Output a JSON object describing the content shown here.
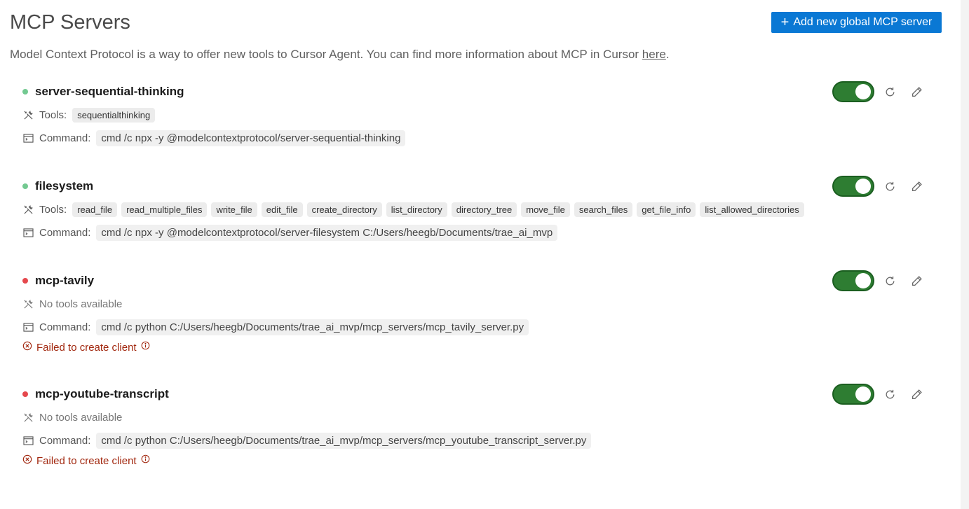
{
  "page": {
    "title": "MCP Servers",
    "add_button": "Add new global MCP server",
    "description": "Model Context Protocol is a way to offer new tools to Cursor Agent. You can find more information about MCP in Cursor ",
    "description_link": "here",
    "description_end": "."
  },
  "labels": {
    "tools": "Tools:",
    "command": "Command:",
    "no_tools": "No tools available",
    "failed": "Failed to create client"
  },
  "servers": [
    {
      "name": "server-sequential-thinking",
      "status": "ok",
      "status_color": "#73c991",
      "enabled": true,
      "tools": [
        "sequentialthinking"
      ],
      "command": "cmd /c npx -y @modelcontextprotocol/server-sequential-thinking"
    },
    {
      "name": "filesystem",
      "status": "ok",
      "status_color": "#73c991",
      "enabled": true,
      "tools": [
        "read_file",
        "read_multiple_files",
        "write_file",
        "edit_file",
        "create_directory",
        "list_directory",
        "directory_tree",
        "move_file",
        "search_files",
        "get_file_info",
        "list_allowed_directories"
      ],
      "command": "cmd /c npx -y @modelcontextprotocol/server-filesystem C:/Users/heegb/Documents/trae_ai_mvp"
    },
    {
      "name": "mcp-tavily",
      "status": "error",
      "status_color": "#e5484d",
      "enabled": true,
      "tools": [],
      "command": "cmd /c python C:/Users/heegb/Documents/trae_ai_mvp/mcp_servers/mcp_tavily_server.py",
      "error": "Failed to create client"
    },
    {
      "name": "mcp-youtube-transcript",
      "status": "error",
      "status_color": "#e5484d",
      "enabled": true,
      "tools": [],
      "command": "cmd /c python C:/Users/heegb/Documents/trae_ai_mvp/mcp_servers/mcp_youtube_transcript_server.py",
      "error": "Failed to create client"
    }
  ],
  "icons": {
    "tools": "wrench-screwdriver-icon",
    "command": "terminal-window-icon",
    "error": "circle-x-icon",
    "info": "info-circle-icon",
    "refresh": "refresh-icon",
    "edit": "pencil-icon",
    "add": "plus-icon"
  },
  "colors": {
    "accent": "#0a78d4",
    "toggle_on": "#2e7d32",
    "error_text": "#a1260d"
  }
}
